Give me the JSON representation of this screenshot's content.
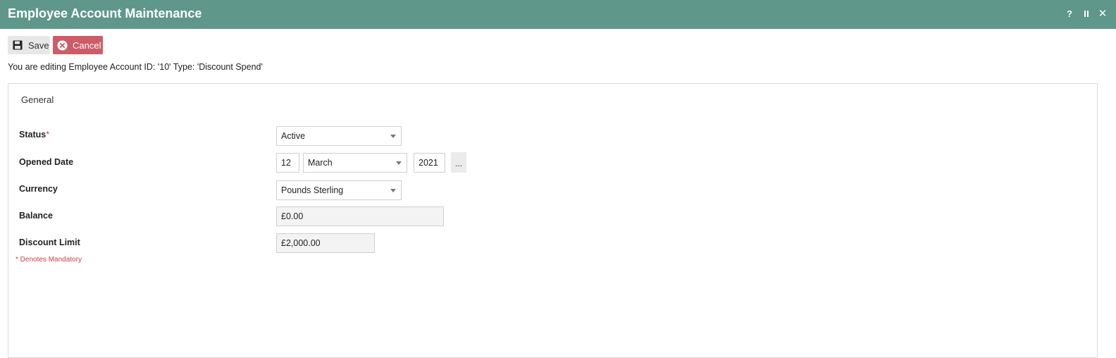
{
  "window": {
    "title": "Employee Account Maintenance",
    "help_symbol": "?",
    "close_symbol": "✕"
  },
  "toolbar": {
    "save_label": "Save",
    "cancel_label": "Cancel"
  },
  "editing_message": "You are editing Employee Account ID: '10' Type: 'Discount Spend'",
  "tabs": [
    {
      "label": "General"
    }
  ],
  "form": {
    "status": {
      "label": "Status",
      "required_mark": "*",
      "value": "Active"
    },
    "opened_date": {
      "label": "Opened Date",
      "day": "12",
      "month": "March",
      "year": "2021",
      "picker_label": "..."
    },
    "currency": {
      "label": "Currency",
      "value": "Pounds Sterling"
    },
    "balance": {
      "label": "Balance",
      "value": "£0.00"
    },
    "discount_limit": {
      "label": "Discount Limit",
      "value": "£2,000.00"
    }
  },
  "mandatory_note": "* Denotes Mandatory",
  "colors": {
    "header": "#5f978a",
    "cancel": "#cd5c67",
    "required": "#cd3c4a"
  }
}
